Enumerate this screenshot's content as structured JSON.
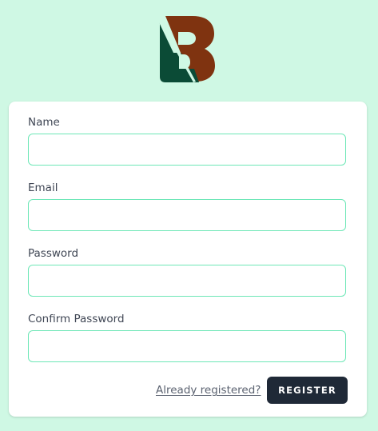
{
  "logo": {
    "letters": "LB",
    "colors": {
      "left": "#0b4b36",
      "right": "#7f3310"
    }
  },
  "form": {
    "fields": [
      {
        "label": "Name",
        "value": ""
      },
      {
        "label": "Email",
        "value": ""
      },
      {
        "label": "Password",
        "value": ""
      },
      {
        "label": "Confirm Password",
        "value": ""
      }
    ],
    "login_link": "Already registered?",
    "submit_label": "REGISTER"
  },
  "colors": {
    "page_background": "#cff8e4",
    "input_border": "#6ee7b7",
    "button_background": "#1f2937"
  }
}
